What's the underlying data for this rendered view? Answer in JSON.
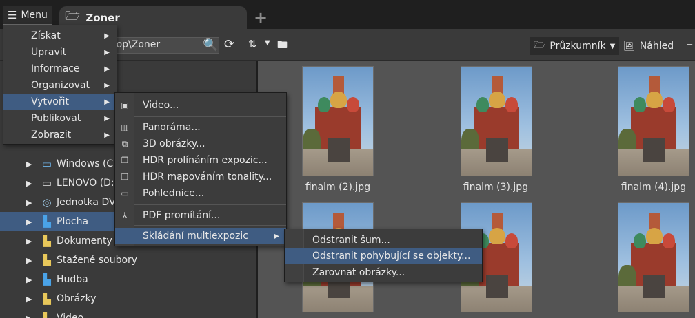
{
  "menu_button": {
    "label": "Menu",
    "icon": "hamburger-icon"
  },
  "tab": {
    "title": "Zoner",
    "icon": "folder-open-icon",
    "new_tab": "+"
  },
  "toolbar": {
    "path": "ktop\\Zoner",
    "view_explorer": "Průzkumník",
    "view_preview": "Náhled"
  },
  "tree": [
    {
      "label": "Windows (C:)",
      "icon": "drive-windows-icon"
    },
    {
      "label": "LENOVO (D:)",
      "icon": "drive-icon"
    },
    {
      "label": "Jednotka DV",
      "icon": "dvd-drive-icon"
    },
    {
      "label": "Plocha",
      "icon": "desktop-folder-icon",
      "selected": true
    },
    {
      "label": "Dokumenty",
      "icon": "documents-folder-icon"
    },
    {
      "label": "Stažené soubory",
      "icon": "downloads-folder-icon"
    },
    {
      "label": "Hudba",
      "icon": "music-folder-icon"
    },
    {
      "label": "Obrázky",
      "icon": "pictures-folder-icon"
    },
    {
      "label": "Video",
      "icon": "video-folder-icon"
    }
  ],
  "thumbnails": [
    {
      "caption": "finalm (2).jpg"
    },
    {
      "caption": "finalm (3).jpg"
    },
    {
      "caption": "finalm (4).jpg"
    }
  ],
  "main_menu": [
    {
      "label": "Získat"
    },
    {
      "label": "Upravit"
    },
    {
      "label": "Informace"
    },
    {
      "label": "Organizovat"
    },
    {
      "label": "Vytvořit",
      "highlighted": true
    },
    {
      "label": "Publikovat"
    },
    {
      "label": "Zobrazit"
    }
  ],
  "create_menu": [
    {
      "label": "Video...",
      "icon": "video-icon"
    },
    {
      "label": "Panoráma...",
      "icon": "panorama-icon"
    },
    {
      "label": "3D obrázky...",
      "icon": "3d-images-icon"
    },
    {
      "label": "HDR prolínáním expozic...",
      "icon": "hdr-blend-icon"
    },
    {
      "label": "HDR mapováním tonality...",
      "icon": "hdr-tone-icon"
    },
    {
      "label": "Pohlednice...",
      "icon": "postcard-icon"
    },
    {
      "label": "PDF promítání...",
      "icon": "pdf-slideshow-icon"
    },
    {
      "label": "Skládání multiexpozic",
      "icon": "",
      "highlighted": true
    }
  ],
  "multiexposure_menu": [
    {
      "label": "Odstranit šum..."
    },
    {
      "label": "Odstranit pohybující se objekty...",
      "highlighted": true
    },
    {
      "label": "Zarovnat obrázky..."
    }
  ],
  "colors": {
    "highlight": "#3f5c82",
    "panel": "#3a3a3a",
    "browser": "#545454"
  }
}
